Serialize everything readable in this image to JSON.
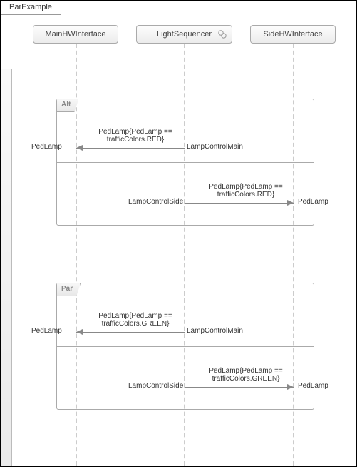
{
  "tab_title": "ParExample",
  "lifelines": {
    "l1": "MainHWInterface",
    "l2": "LightSequencer",
    "l3": "SideHWInterface"
  },
  "fragments": [
    {
      "operator": "Alt",
      "operands": [
        {
          "message": "PedLamp{PedLamp == trafficColors.RED}",
          "from_role": "LampControlMain",
          "to_role": "PedLamp"
        },
        {
          "message": "PedLamp{PedLamp == trafficColors.RED}",
          "from_role": "LampControlSide",
          "to_role": "PedLamp"
        }
      ]
    },
    {
      "operator": "Par",
      "operands": [
        {
          "message": "PedLamp{PedLamp == trafficColors.GREEN}",
          "from_role": "LampControlMain",
          "to_role": "PedLamp"
        },
        {
          "message": "PedLamp{PedLamp == trafficColors.GREEN}",
          "from_role": "LampControlSide",
          "to_role": "PedLamp"
        }
      ]
    }
  ]
}
